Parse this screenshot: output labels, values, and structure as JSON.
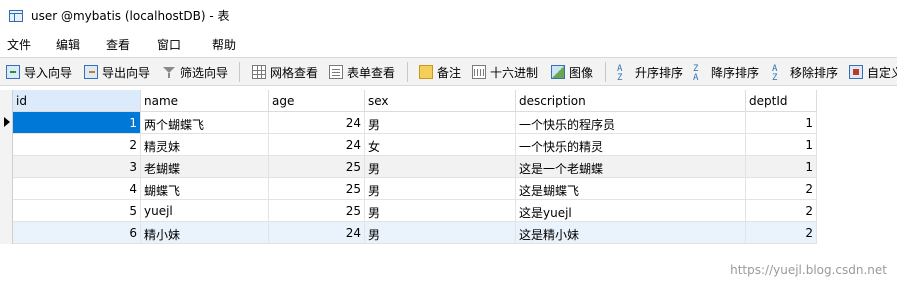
{
  "window": {
    "title": "user @mybatis (localhostDB) - 表"
  },
  "menu": [
    "文件",
    "编辑",
    "查看",
    "窗口",
    "帮助"
  ],
  "toolbar": {
    "import": "导入向导",
    "export": "导出向导",
    "filter": "筛选向导",
    "grid_view": "网格查看",
    "form_view": "表单查看",
    "memo": "备注",
    "hex": "十六进制",
    "image": "图像",
    "sort_asc": "升序排序",
    "sort_desc": "降序排序",
    "remove_sort": "移除排序",
    "custom": "自定义"
  },
  "icons": {
    "import": "import-wizard-icon",
    "export": "export-wizard-icon",
    "filter": "filter-funnel-icon",
    "grid_view": "grid-icon",
    "form_view": "form-icon",
    "memo": "memo-icon",
    "hex": "hex-icon",
    "image": "image-icon",
    "sort_asc": "sort-ascending-icon",
    "sort_desc": "sort-descending-icon",
    "remove_sort": "remove-sort-icon",
    "custom": "custom-icon"
  },
  "table": {
    "columns": [
      "id",
      "name",
      "age",
      "sex",
      "description",
      "deptId"
    ],
    "rows": [
      [
        "1",
        "两个蝴蝶飞",
        "24",
        "男",
        "一个快乐的程序员",
        "1"
      ],
      [
        "2",
        "精灵妹",
        "24",
        "女",
        "一个快乐的精灵",
        "1"
      ],
      [
        "3",
        "老蝴蝶",
        "25",
        "男",
        "这是一个老蝴蝶",
        "1"
      ],
      [
        "4",
        "蝴蝶飞",
        "25",
        "男",
        "这是蝴蝶飞",
        "2"
      ],
      [
        "5",
        "yuejl",
        "25",
        "男",
        "这是yuejl",
        "2"
      ],
      [
        "6",
        "精小妹",
        "24",
        "男",
        "这是精小妹",
        "2"
      ]
    ],
    "selected_row": 1
  },
  "colors": {
    "selection": "#0078d7",
    "toolbar_bg": "#f3f3f3",
    "header_active": "#dcebfb"
  },
  "watermark": "https://yuejl.blog.csdn.net"
}
